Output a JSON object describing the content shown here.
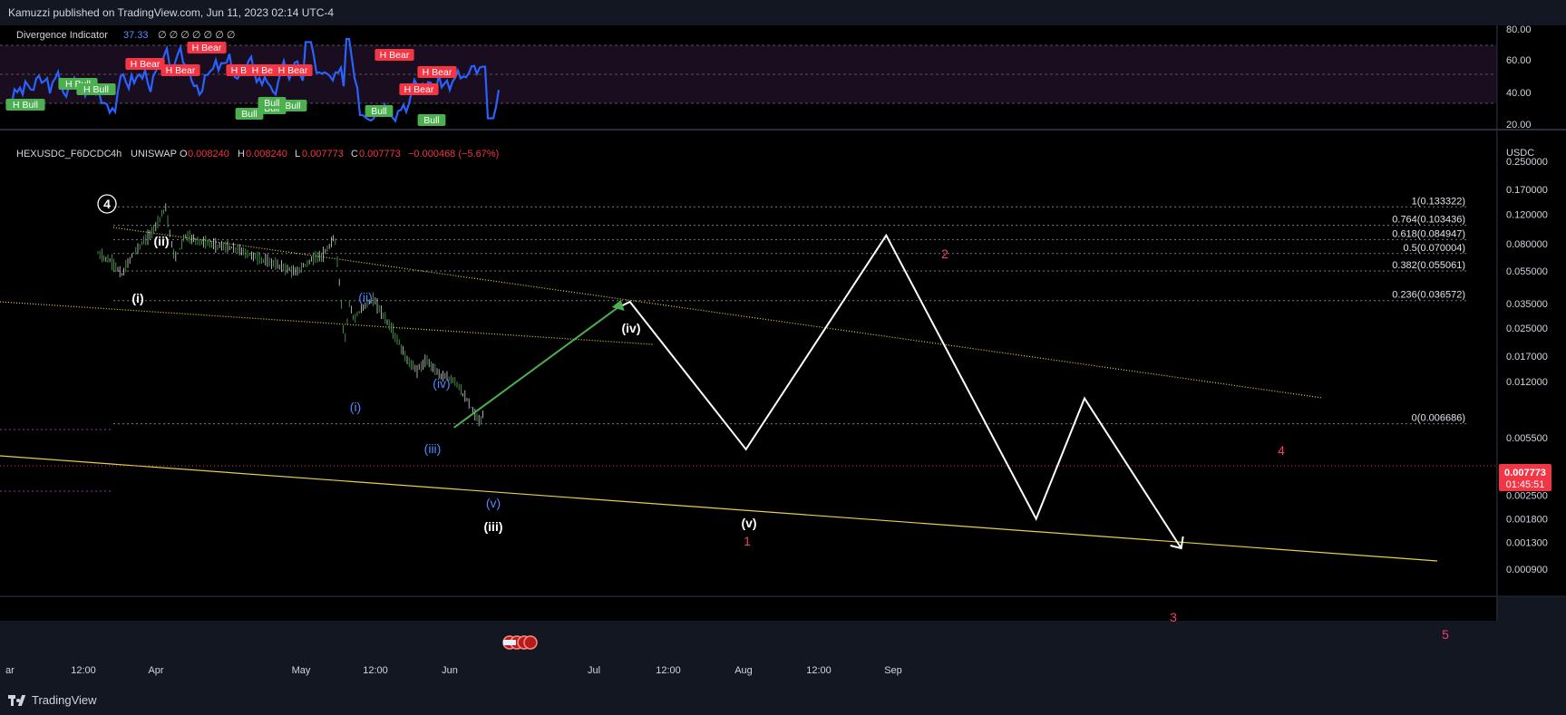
{
  "header": {
    "publish_text": "Kamuzzi published on TradingView.com, Jun 11, 2023 02:14 UTC-4"
  },
  "footer": {
    "brand": "TradingView"
  },
  "colors": {
    "background": "#000000",
    "frame": "#131722",
    "bull": "#4caf50",
    "bear": "#f23645",
    "oscillator": "#2962ff",
    "trendline": "#e6d04a",
    "projection": "#ffffff",
    "impulse_green": "#4caf50",
    "wave_blue": "#4f8bff",
    "wave_red": "#f23f6b"
  },
  "indicator": {
    "name": "Divergence Indicator",
    "value": "37.33",
    "extra_values": "∅ ∅ ∅ ∅ ∅ ∅ ∅",
    "axis_ticks": [
      "80.00",
      "60.00",
      "40.00",
      "20.00"
    ],
    "labels": [
      {
        "text": "H Bull",
        "type": "bull"
      },
      {
        "text": "H Bull",
        "type": "bull"
      },
      {
        "text": "H Bull",
        "type": "bull"
      },
      {
        "text": "H Bear",
        "type": "bear"
      },
      {
        "text": "H Bear",
        "type": "bear"
      },
      {
        "text": "H Bear",
        "type": "bear"
      },
      {
        "text": "H Bear",
        "type": "bear"
      },
      {
        "text": "H Bear",
        "type": "bear"
      },
      {
        "text": "H Bear",
        "type": "bear"
      },
      {
        "text": "Bull",
        "type": "bull"
      },
      {
        "text": "Bull",
        "type": "bull"
      },
      {
        "text": "Bull",
        "type": "bull"
      },
      {
        "text": "Bull",
        "type": "bull"
      },
      {
        "text": "H Bear",
        "type": "bear"
      },
      {
        "text": "H Bear",
        "type": "bear"
      },
      {
        "text": "H Bear",
        "type": "bear"
      },
      {
        "text": "Bull",
        "type": "bull"
      },
      {
        "text": "Bull",
        "type": "bull"
      }
    ]
  },
  "symbol": {
    "name": "HEXUSDC_F6DCDC",
    "interval": "4h",
    "exchange": "UNISWAP",
    "o_label": "O",
    "o_value": "0.008240",
    "h_label": "H",
    "h_value": "0.008240",
    "l_label": "L",
    "l_value": "0.007773",
    "c_label": "C",
    "c_value": "0.007773",
    "change": "−0.000468 (−5.67%)",
    "last_price": "0.007773",
    "countdown": "01:45:51"
  },
  "chart_data": {
    "type": "line",
    "title": "HEXUSDC_F6DCDC, 4h, UNISWAP",
    "xlabel": "",
    "ylabel": "USDC",
    "y_scale": "log",
    "y_axis_ticks": [
      "0.250000",
      "0.170000",
      "0.120000",
      "0.080000",
      "0.055000",
      "0.035000",
      "0.025000",
      "0.017000",
      "0.012000",
      "0.005500",
      "0.003500",
      "0.002500",
      "0.001800",
      "0.001300",
      "0.000900"
    ],
    "x_axis_ticks": [
      "ar",
      "12:00",
      "Apr",
      "May",
      "12:00",
      "Jun",
      "Jul",
      "12:00",
      "Aug",
      "12:00",
      "Sep"
    ],
    "fib_levels": [
      {
        "label": "1(0.133322)",
        "ratio": 1,
        "price": 0.133322
      },
      {
        "label": "0.764(0.103436)",
        "ratio": 0.764,
        "price": 0.103436
      },
      {
        "label": "0.618(0.084947)",
        "ratio": 0.618,
        "price": 0.084947
      },
      {
        "label": "0.5(0.070004)",
        "ratio": 0.5,
        "price": 0.070004
      },
      {
        "label": "0.382(0.055061)",
        "ratio": 0.382,
        "price": 0.055061
      },
      {
        "label": "0.236(0.036572)",
        "ratio": 0.236,
        "price": 0.036572
      },
      {
        "label": "0(0.006686)",
        "ratio": 0,
        "price": 0.006686
      }
    ],
    "price_path": {
      "name": "price",
      "points": [
        {
          "t": "Mar 20",
          "v": 0.07
        },
        {
          "t": "Mar 23",
          "v": 0.062
        },
        {
          "t": "Mar 25",
          "v": 0.052
        },
        {
          "t": "Mar 27",
          "v": 0.068
        },
        {
          "t": "Mar 29",
          "v": 0.08
        },
        {
          "t": "Mar 31",
          "v": 0.092
        },
        {
          "t": "Apr 2",
          "v": 0.118
        },
        {
          "t": "Apr 3",
          "v": 0.133
        },
        {
          "t": "Apr 4",
          "v": 0.085
        },
        {
          "t": "Apr 5",
          "v": 0.065
        },
        {
          "t": "Apr 7",
          "v": 0.09
        },
        {
          "t": "Apr 10",
          "v": 0.083
        },
        {
          "t": "Apr 14",
          "v": 0.078
        },
        {
          "t": "Apr 18",
          "v": 0.074
        },
        {
          "t": "Apr 22",
          "v": 0.066
        },
        {
          "t": "Apr 26",
          "v": 0.06
        },
        {
          "t": "Apr 30",
          "v": 0.054
        },
        {
          "t": "May 3",
          "v": 0.064
        },
        {
          "t": "May 6",
          "v": 0.07
        },
        {
          "t": "May 8",
          "v": 0.088
        },
        {
          "t": "May 9",
          "v": 0.045
        },
        {
          "t": "May 10",
          "v": 0.02
        },
        {
          "t": "May 11",
          "v": 0.036
        },
        {
          "t": "May 12",
          "v": 0.028
        },
        {
          "t": "May 14",
          "v": 0.034
        },
        {
          "t": "May 16",
          "v": 0.037
        },
        {
          "t": "May 18",
          "v": 0.03
        },
        {
          "t": "May 20",
          "v": 0.024
        },
        {
          "t": "May 23",
          "v": 0.016
        },
        {
          "t": "May 25",
          "v": 0.014
        },
        {
          "t": "May 27",
          "v": 0.016
        },
        {
          "t": "May 30",
          "v": 0.013
        },
        {
          "t": "Jun 2",
          "v": 0.012
        },
        {
          "t": "Jun 5",
          "v": 0.0085
        },
        {
          "t": "Jun 7",
          "v": 0.0068
        },
        {
          "t": "Jun 8",
          "v": 0.0078
        }
      ]
    },
    "projection": [
      {
        "t": "Jun 11",
        "v": 0.0065,
        "label": ""
      },
      {
        "t": "Jul 8",
        "v": 0.036,
        "label": "(iv)"
      },
      {
        "t": "Aug 1",
        "v": 0.0047,
        "label": "(v) 1"
      },
      {
        "t": "Aug 30",
        "v": 0.09,
        "label": "2"
      },
      {
        "t": "Sep 30",
        "v": 0.0018,
        "label": "3"
      },
      {
        "t": "Oct 10",
        "v": 0.0095,
        "label": "4"
      },
      {
        "t": "Oct 30",
        "v": 0.0012,
        "label": "5"
      }
    ],
    "wave_labels": [
      {
        "text": "4",
        "style": "circled",
        "color": "white"
      },
      {
        "text": "(ii)",
        "color": "white"
      },
      {
        "text": "(i)",
        "color": "white"
      },
      {
        "text": "(ii)",
        "color": "blue"
      },
      {
        "text": "(i)",
        "color": "blue"
      },
      {
        "text": "(iv)",
        "color": "blue"
      },
      {
        "text": "(iii)",
        "color": "blue"
      },
      {
        "text": "(v)",
        "color": "blue"
      },
      {
        "text": "(iii)",
        "color": "white"
      },
      {
        "text": "(iv)",
        "color": "white"
      },
      {
        "text": "(v)",
        "color": "white"
      },
      {
        "text": "1",
        "color": "red"
      },
      {
        "text": "2",
        "color": "red"
      },
      {
        "text": "3",
        "color": "red"
      },
      {
        "text": "4",
        "color": "red"
      },
      {
        "text": "5",
        "color": "red"
      }
    ],
    "trendlines": [
      {
        "name": "upper channel",
        "style": "dotted"
      },
      {
        "name": "lower channel",
        "style": "dotted"
      },
      {
        "name": "support",
        "style": "solid"
      }
    ],
    "grid": false
  }
}
